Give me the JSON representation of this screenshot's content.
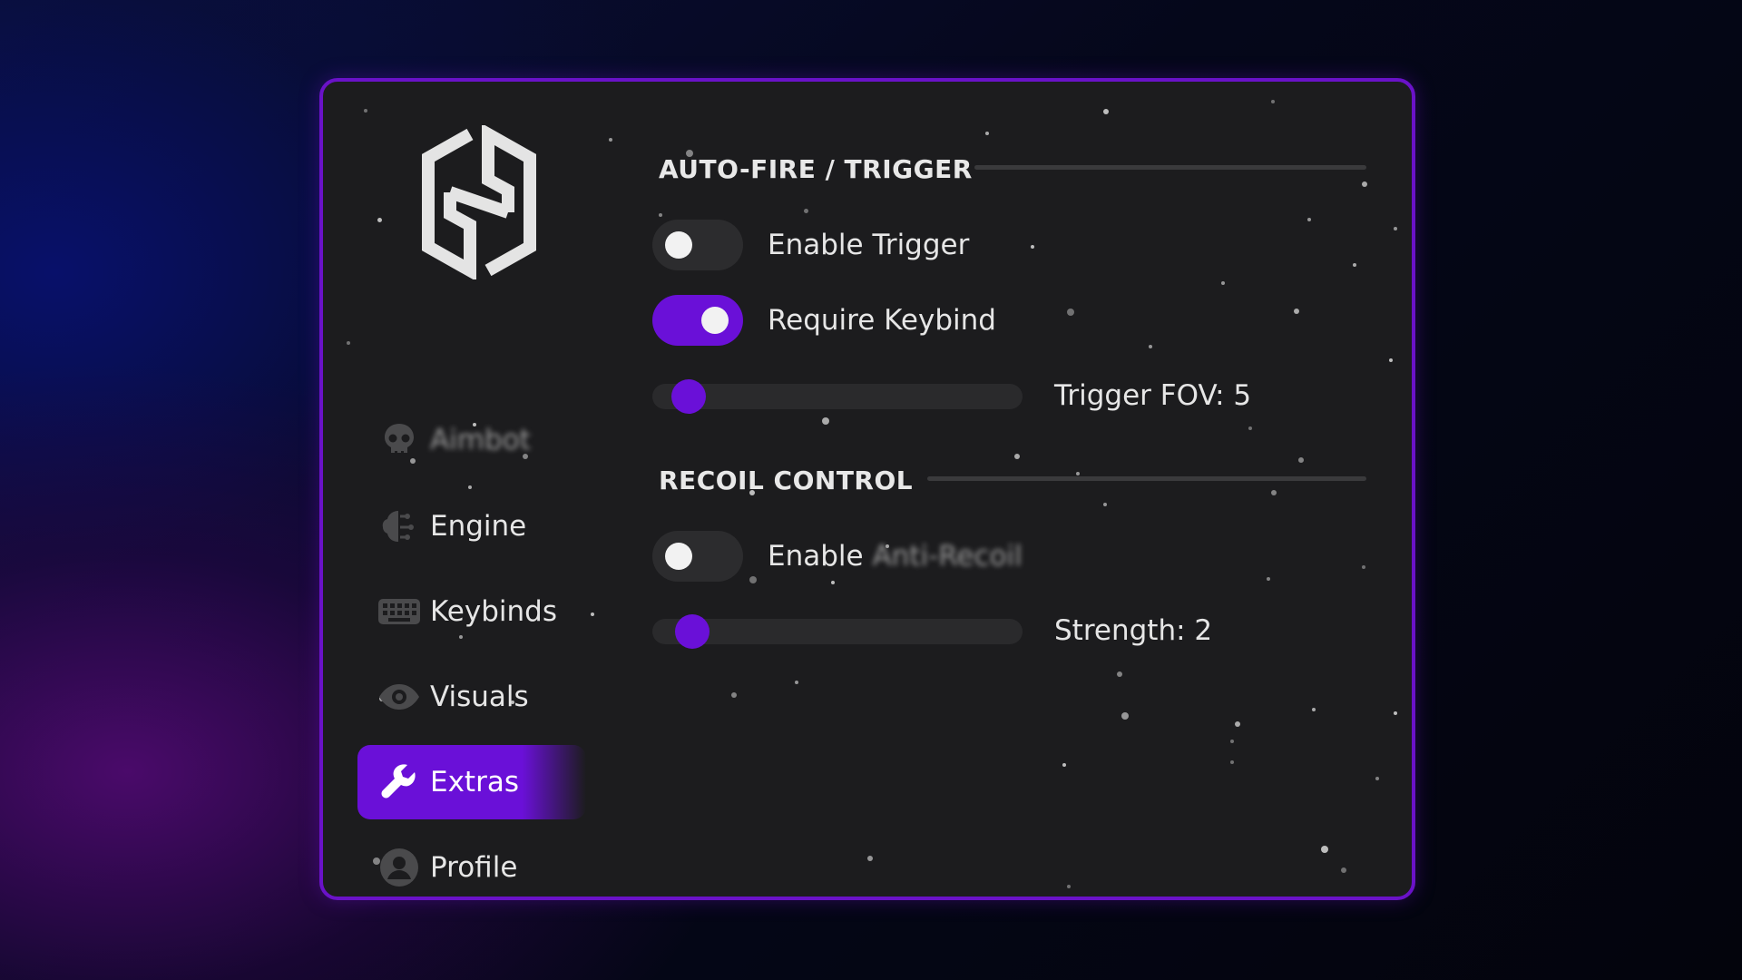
{
  "colors": {
    "accent": "#6a10d8",
    "panel_bg": "#1c1c1e",
    "border": "#6a12c8",
    "text": "#e6e6e6"
  },
  "logo": {
    "icon": "hexagon-logo-icon"
  },
  "sidebar": {
    "items": [
      {
        "label": "Aimbot",
        "icon": "skull-icon",
        "active": false,
        "redacted": true
      },
      {
        "label": "Engine",
        "icon": "brain-icon",
        "active": false
      },
      {
        "label": "Keybinds",
        "icon": "keyboard-icon",
        "active": false
      },
      {
        "label": "Visuals",
        "icon": "eye-icon",
        "active": false
      },
      {
        "label": "Extras",
        "icon": "wrench-icon",
        "active": true
      },
      {
        "label": "Profile",
        "icon": "user-icon",
        "active": false
      }
    ]
  },
  "sections": {
    "trigger": {
      "title": "AUTO-FIRE / TRIGGER",
      "enable_trigger": {
        "label": "Enable Trigger",
        "on": false
      },
      "require_keybind": {
        "label": "Require Keybind",
        "on": true
      },
      "fov": {
        "label": "Trigger FOV: 5",
        "value": 5,
        "min": 1,
        "max": 100
      }
    },
    "recoil": {
      "title": "RECOIL CONTROL",
      "enable_prefix": "Enable",
      "enable_redacted": "Anti-Recoil",
      "enable_on": false,
      "strength": {
        "label": "Strength: 2",
        "value": 2,
        "min": 1,
        "max": 20
      }
    }
  }
}
